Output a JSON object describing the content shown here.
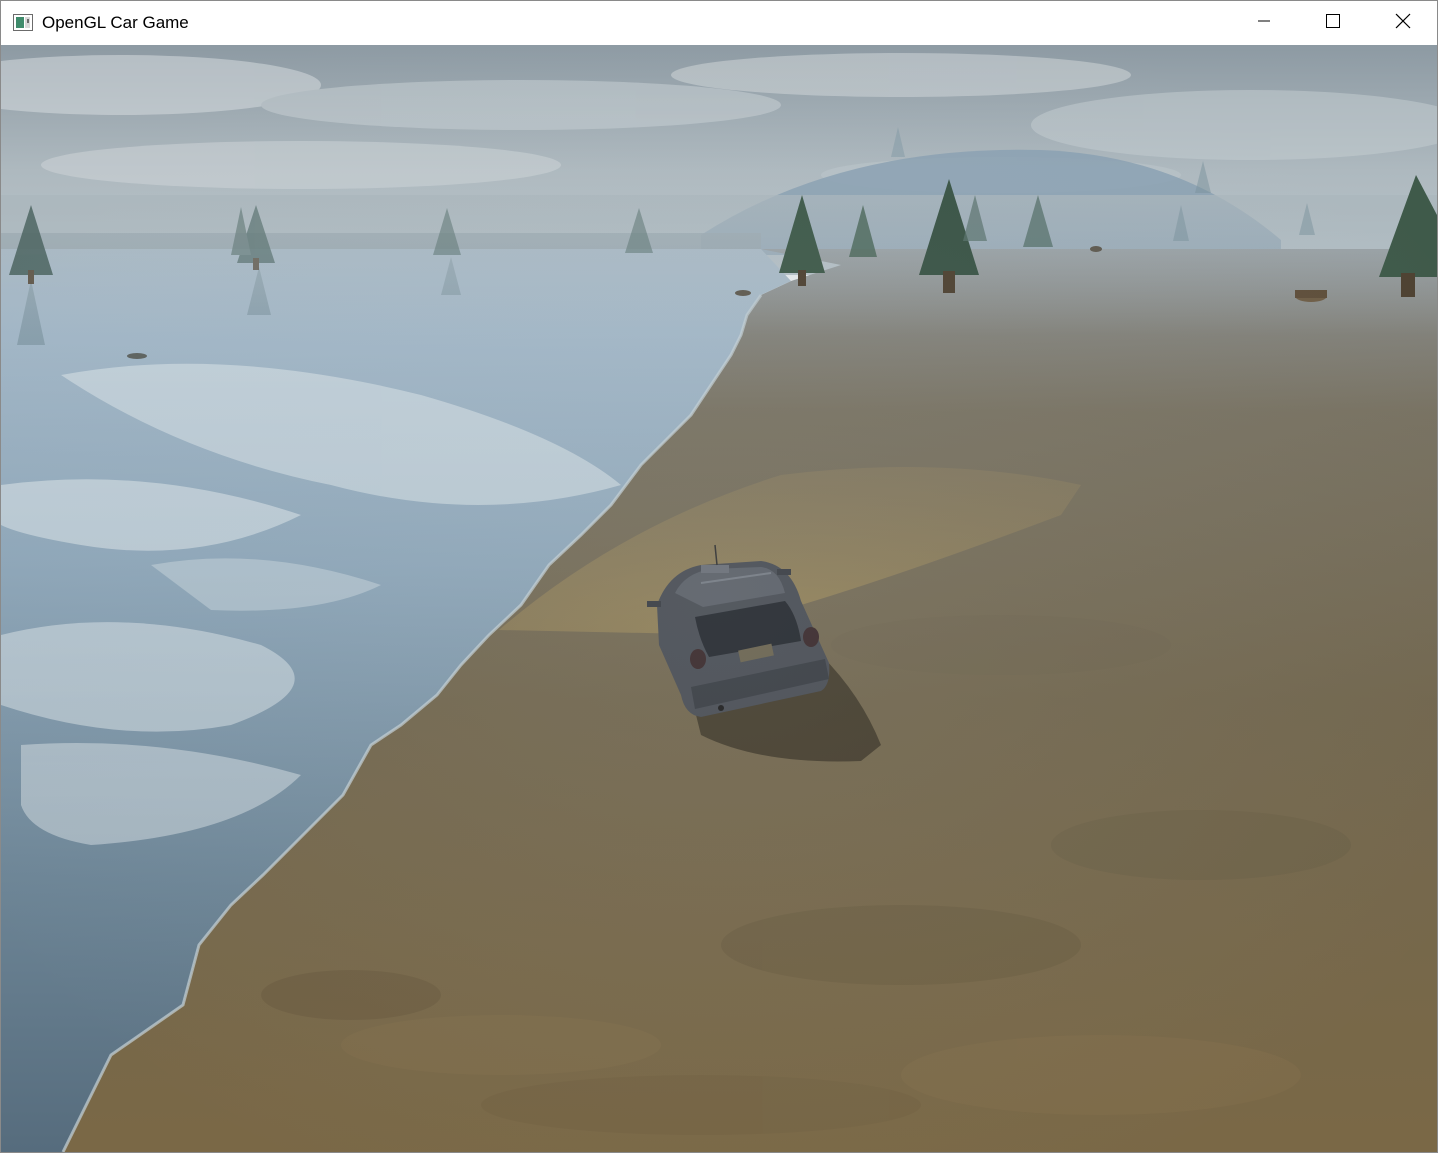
{
  "window": {
    "title": "OpenGL Car Game",
    "icon": "app-window-icon",
    "controls": [
      "minimize-icon",
      "maximize-icon",
      "close-icon"
    ]
  },
  "scene": {
    "elements": [
      "sky",
      "distant-hill",
      "lake",
      "dirt-ground",
      "pine-trees",
      "tree-stump",
      "player-car",
      "headlight-beam",
      "car-shadow"
    ],
    "colors": {
      "sky_top": "#8d9aa3",
      "sky_haze": "#b4c0c7",
      "hill": "#7f97ad",
      "water_light": "#a9bccb",
      "water_dark": "#5e7487",
      "ground_far": "#6f6e62",
      "ground_near": "#7a6845",
      "headlight": "#a8945e",
      "car_body": "#4a4e55",
      "tree": "#3f5a4a"
    }
  }
}
